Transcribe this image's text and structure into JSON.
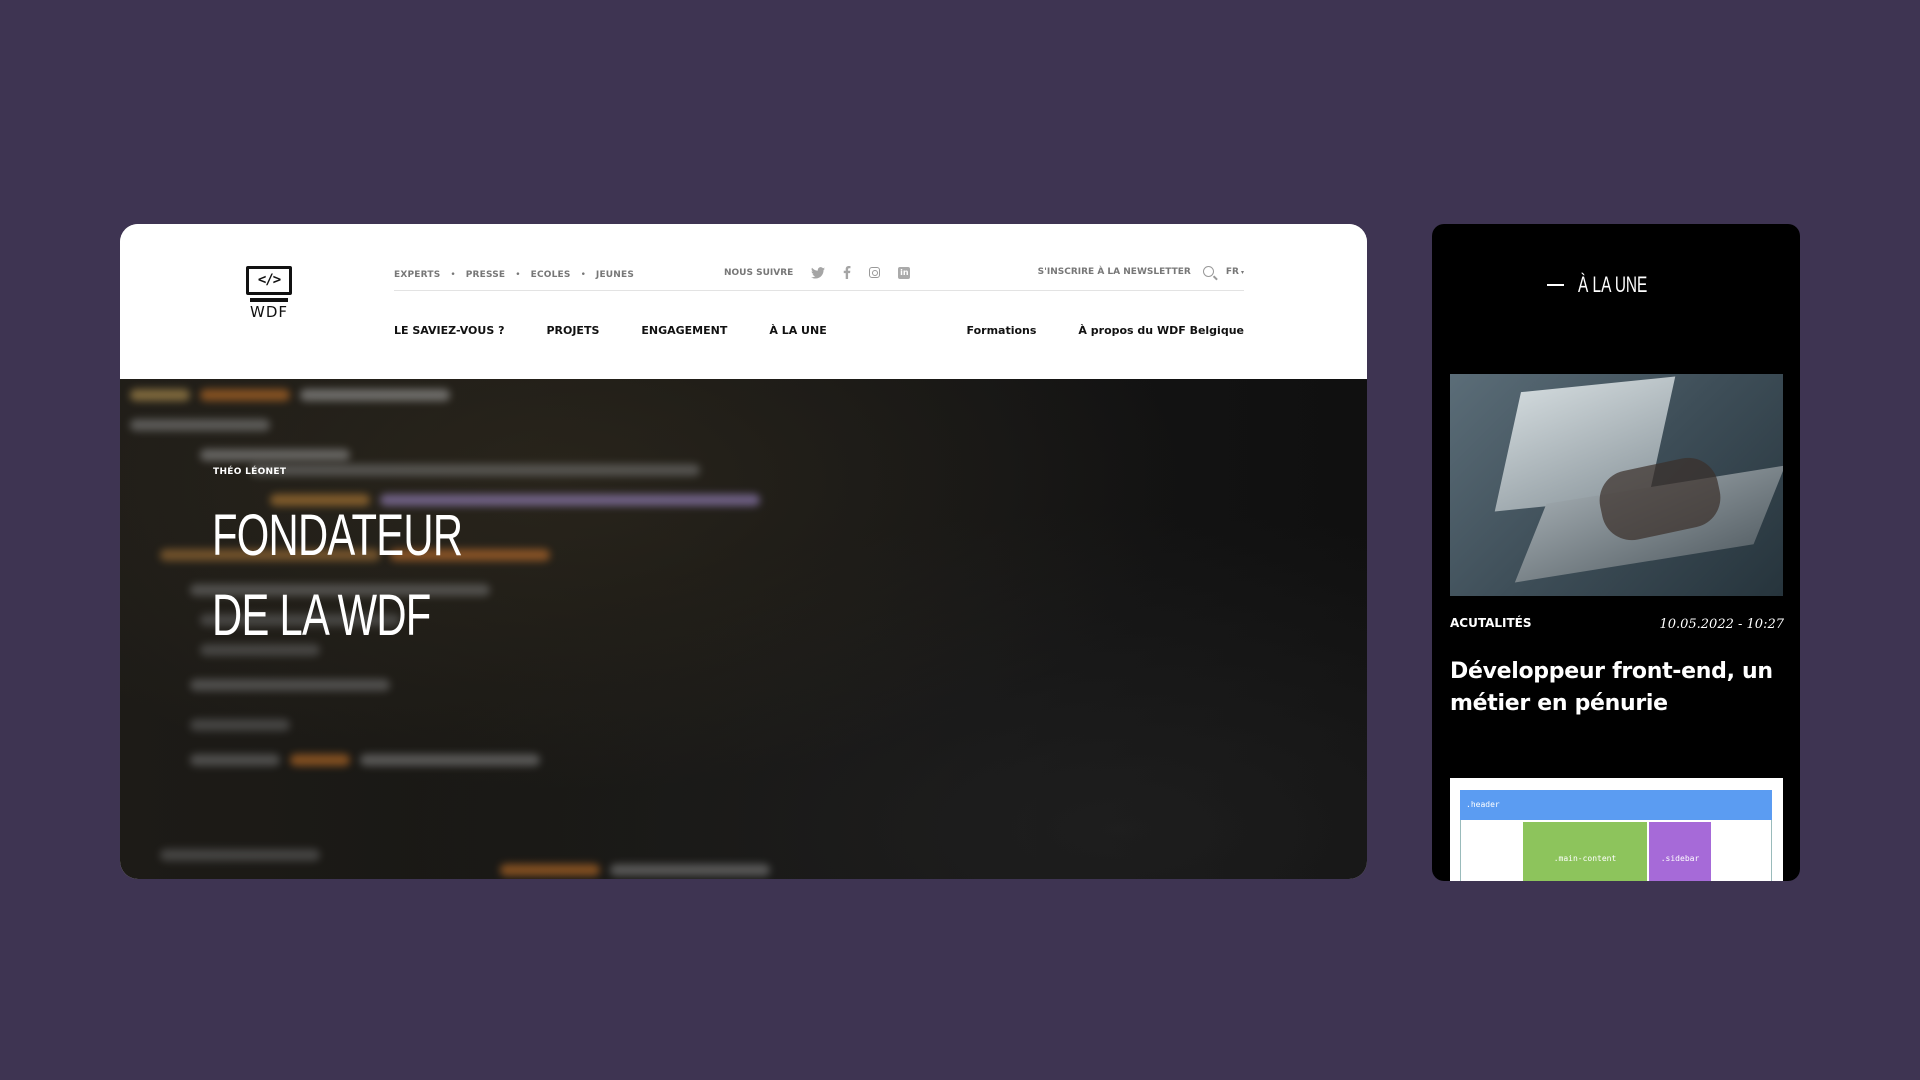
{
  "desktop": {
    "logo": {
      "glyph": "</>",
      "word": "WDF"
    },
    "top_links": [
      "EXPERTS",
      "PRESSE",
      "ECOLES",
      "JEUNES"
    ],
    "follow_label": "NOUS SUIVRE",
    "social_icons": [
      "twitter-icon",
      "facebook-icon",
      "instagram-icon",
      "linkedin-icon"
    ],
    "newsletter_label": "S'INSCRIRE À LA NEWSLETTER",
    "language": "FR",
    "main_nav": [
      "LE SAVIEZ-VOUS ?",
      "PROJETS",
      "ENGAGEMENT",
      "À LA UNE"
    ],
    "secondary_nav": [
      "Formations",
      "À propos du WDF Belgique"
    ],
    "hero": {
      "author": "THÉO LÉONET",
      "title_line1": "FONDATEUR",
      "title_line2": "DE LA WDF"
    }
  },
  "mobile": {
    "section_title": "À LA UNE",
    "article": {
      "category": "ACUTALITÉS",
      "date": "10.05.2022 - 10:27",
      "headline": "Développeur front-end, un métier en pénurie"
    },
    "thumb_labels": {
      "header": ".header",
      "main": ".main-content",
      "sidebar": ".sidebar"
    }
  },
  "colors": {
    "background": "#3e3452",
    "mobile_background": "#000000",
    "thumb_header": "#5b9cf2",
    "thumb_main": "#8dc45c",
    "thumb_sidebar": "#a66ad8"
  }
}
